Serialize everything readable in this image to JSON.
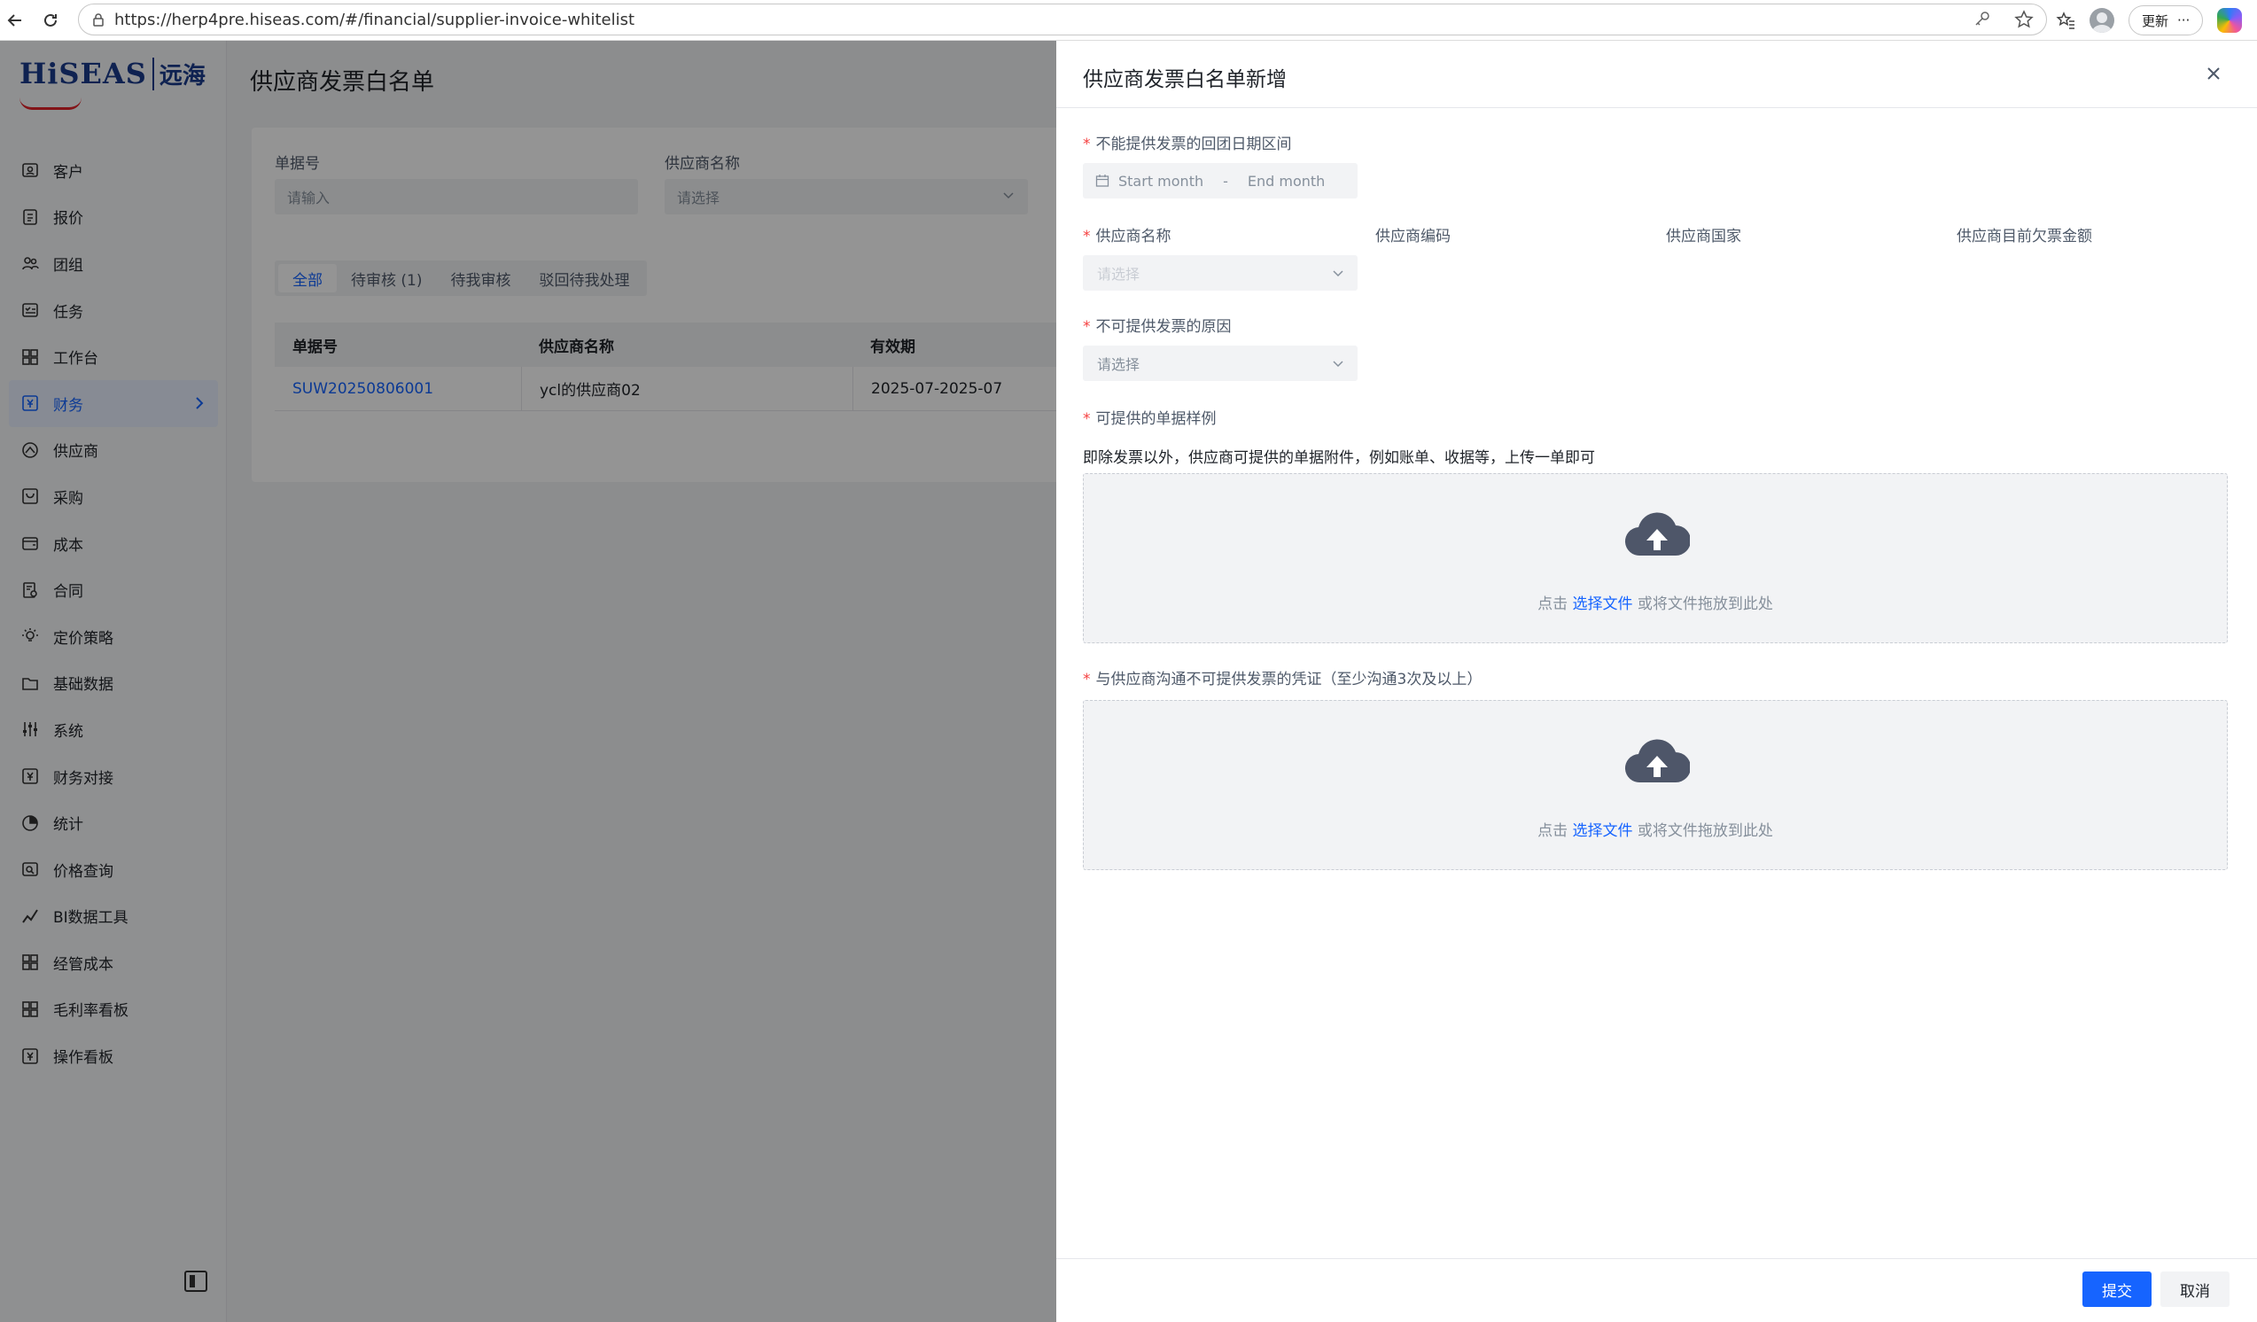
{
  "browser": {
    "url": "https://herp4pre.hiseas.com/#/financial/supplier-invoice-whitelist",
    "update_label": "更新",
    "more_label": "···"
  },
  "logo": {
    "brand": "HiSEAS",
    "brand_cn": "远海"
  },
  "sidebar": {
    "items": [
      {
        "label": "客户",
        "icon": "user-card-icon"
      },
      {
        "label": "报价",
        "icon": "quote-icon"
      },
      {
        "label": "团组",
        "icon": "group-icon"
      },
      {
        "label": "任务",
        "icon": "task-icon"
      },
      {
        "label": "工作台",
        "icon": "workbench-icon"
      },
      {
        "label": "财务",
        "icon": "finance-icon",
        "active": true
      },
      {
        "label": "供应商",
        "icon": "supplier-icon"
      },
      {
        "label": "采购",
        "icon": "purchase-icon"
      },
      {
        "label": "成本",
        "icon": "cost-icon"
      },
      {
        "label": "合同",
        "icon": "contract-icon"
      },
      {
        "label": "定价策略",
        "icon": "bulb-icon"
      },
      {
        "label": "基础数据",
        "icon": "folder-icon"
      },
      {
        "label": "系统",
        "icon": "settings-sliders-icon"
      },
      {
        "label": "财务对接",
        "icon": "finance-link-icon"
      },
      {
        "label": "统计",
        "icon": "pie-chart-icon"
      },
      {
        "label": "价格查询",
        "icon": "price-search-icon"
      },
      {
        "label": "BI数据工具",
        "icon": "line-chart-icon"
      },
      {
        "label": "经管成本",
        "icon": "grid-icon"
      },
      {
        "label": "毛利率看板",
        "icon": "dashboard-icon"
      },
      {
        "label": "操作看板",
        "icon": "operation-board-icon"
      }
    ]
  },
  "page": {
    "title": "供应商发票白名单",
    "filters": {
      "doc_no_label": "单据号",
      "doc_no_placeholder": "请输入",
      "supplier_label": "供应商名称",
      "supplier_placeholder": "请选择"
    },
    "tabs": [
      "全部",
      "待审核 (1)",
      "待我审核",
      "驳回待我处理"
    ],
    "table": {
      "columns": [
        "单据号",
        "供应商名称",
        "有效期"
      ],
      "rows": [
        [
          "SUW20250806001",
          "ycl的供应商02",
          "2025-07-2025-07"
        ]
      ]
    }
  },
  "drawer": {
    "title": "供应商发票白名单新增",
    "date_range_label": "不能提供发票的回团日期区间",
    "start_placeholder": "Start month",
    "range_sep": "-",
    "end_placeholder": "End month",
    "supplier_name_label": "供应商名称",
    "supplier_name_placeholder": "请选择",
    "supplier_code_label": "供应商编码",
    "supplier_country_label": "供应商国家",
    "supplier_owed_label": "供应商目前欠票金额",
    "reason_label": "不可提供发票的原因",
    "reason_placeholder": "请选择",
    "sample_label": "可提供的单据样例",
    "sample_hint": "即除发票以外，供应商可提供的单据附件，例如账单、收据等，上传一单即可",
    "upload_prefix": "点击 ",
    "upload_link": "选择文件",
    "upload_suffix": " 或将文件拖放到此处",
    "proof_label": "与供应商沟通不可提供发票的凭证（至少沟通3次及以上）",
    "submit_label": "提交",
    "cancel_label": "取消"
  }
}
